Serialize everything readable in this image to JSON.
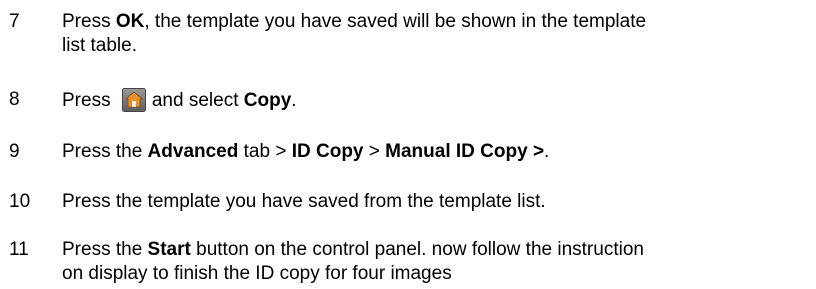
{
  "steps": [
    {
      "number": "7",
      "parts": [
        "Press ",
        "OK",
        ", the template you have saved will be shown in the template",
        "list table."
      ]
    },
    {
      "number": "8",
      "parts": [
        "Press ",
        "and select ",
        "Copy",
        "."
      ],
      "icon": "home-icon"
    },
    {
      "number": "9",
      "parts": [
        "Press the ",
        "Advanced",
        " tab > ",
        "ID Copy",
        " > ",
        "Manual ID Copy >",
        "."
      ]
    },
    {
      "number": "10",
      "parts": [
        "Press the template you have saved from the template list."
      ]
    },
    {
      "number": "11",
      "parts": [
        "Press the ",
        "Start",
        " button on the control panel. now follow the instruction",
        "on display to finish the ID copy for four images"
      ]
    }
  ],
  "colors": {
    "text": "#000000",
    "icon_bg": "#7a7a7a",
    "icon_house": "#e08a2a"
  }
}
